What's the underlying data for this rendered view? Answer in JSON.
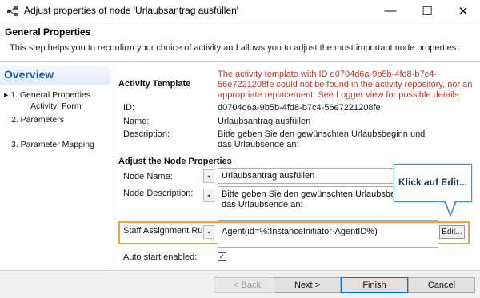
{
  "window": {
    "title": "Adjust properties of node 'Urlaubsantrag ausfüllen'",
    "minimize": "—",
    "maximize": "☐",
    "close": "✕"
  },
  "header": {
    "title": "General Properties",
    "description": "This step helps you to reconfirm your choice of activity and allows you to adjust the most important node properties."
  },
  "nav": {
    "title": "Overview",
    "items": [
      {
        "label": "▸ 1.  General Properties"
      },
      {
        "label": "Activity: Form"
      },
      {
        "label": "2.  Parameters"
      },
      {
        "label": "3.  Parameter Mapping"
      }
    ]
  },
  "activity_template": {
    "section_title": "Activity Template",
    "error": "The activity template with ID d0704d6a-9b5b-4fd8-b7c4-56e7221208fe could not be found in the activity repository, nor an appropriate replacement. See Logger view for possible details.",
    "id_label": "ID:",
    "id_value": "d0704d6a-9b5b-4fd8-b7c4-56e7221208fe",
    "name_label": "Name:",
    "name_value": "Urlaubsantrag ausfüllen",
    "description_label": "Description:",
    "description_value": "Bitte geben Sie den gewünschten Urlaubsbeginn und das Urlaubsende an:"
  },
  "node_properties": {
    "section_title": "Adjust the Node Properties",
    "node_name_label": "Node Name:",
    "node_name_value": "Urlaubsantrag ausfüllen",
    "node_description_label": "Node Description:",
    "node_description_value": "Bitte geben Sie den gewünschten Urlaubsbeginn und das Urlaubsende an:",
    "staff_label": "Staff Assignment Rule:",
    "staff_value": "Agent(id=%:InstanceInitiator-AgentID%)",
    "edit_label": "Edit...",
    "auto_start_label": "Auto start enabled:",
    "auto_start_checked": true
  },
  "callout": {
    "text": "Klick auf Edit..."
  },
  "footer": {
    "back": "< Back",
    "next": "Next >",
    "finish": "Finish",
    "cancel": "Cancel"
  },
  "colors": {
    "error": "#c0392b",
    "highlight": "#f0a23b",
    "callout_border": "#4a90d9",
    "nav_title": "#1f5fa8"
  }
}
